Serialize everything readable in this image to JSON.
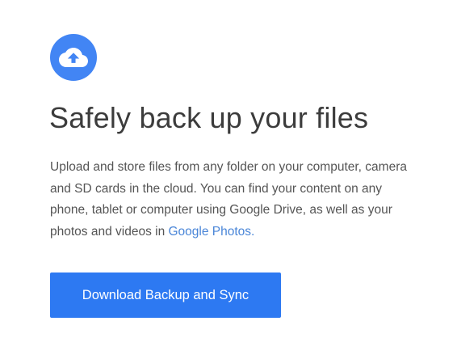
{
  "hero": {
    "icon": "cloud-upload-icon",
    "icon_color": "#4285f4",
    "headline": "Safely back up your files",
    "description_lines": [
      "Upload and store files from any folder on your computer, camera",
      "and SD cards in the cloud. You can find your content on any",
      "phone, tablet or computer using Google Drive, as well as your",
      "photos and videos in"
    ],
    "description_link": "Google Photos.",
    "link_color": "#4a86d8",
    "download_button_label": "Download Backup and Sync",
    "button_color": "#2d79f2"
  }
}
